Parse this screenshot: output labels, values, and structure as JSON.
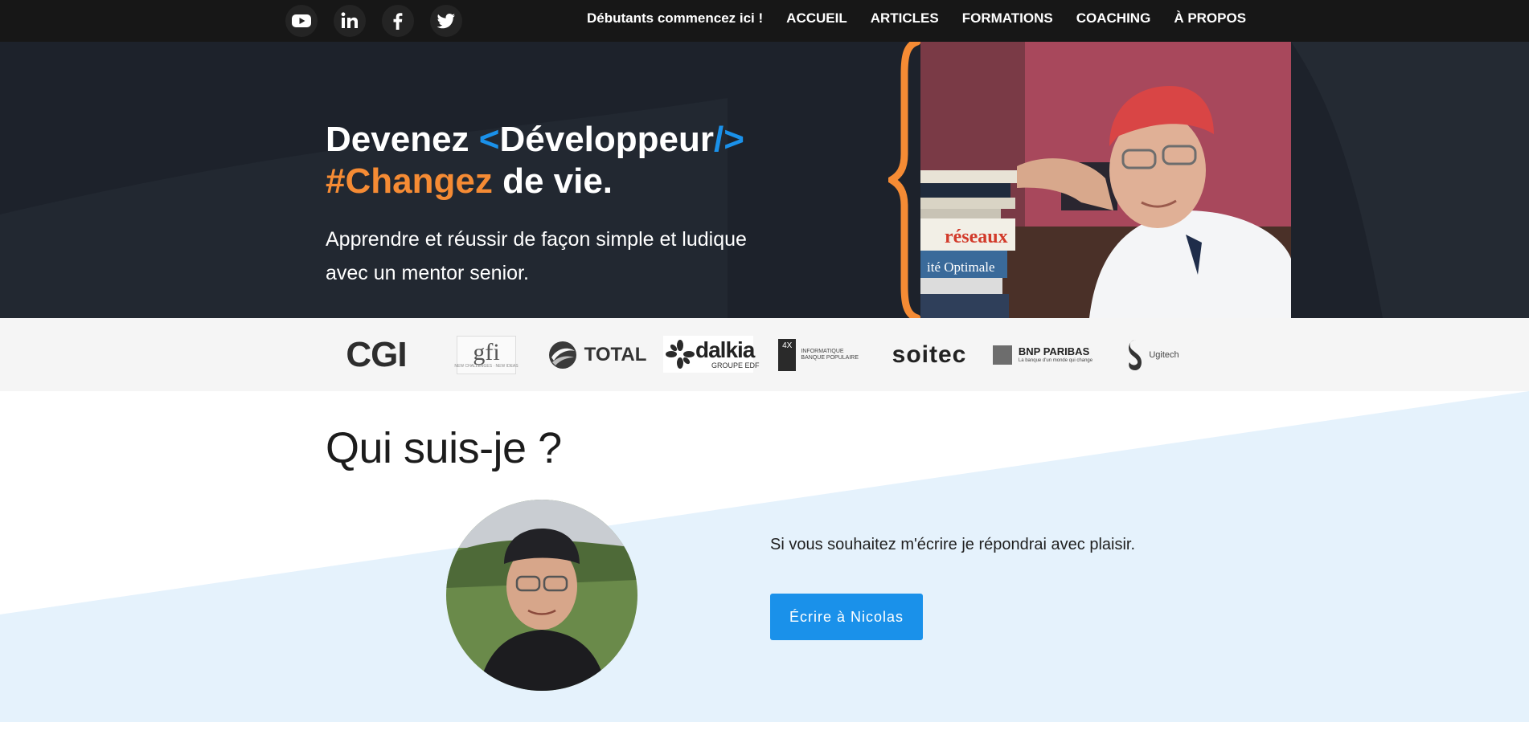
{
  "social": {
    "icons": [
      "youtube-icon",
      "linkedin-icon",
      "facebook-icon",
      "twitter-icon"
    ]
  },
  "nav": {
    "items": [
      {
        "label": "Débutants commencez ici !"
      },
      {
        "label": "ACCUEIL"
      },
      {
        "label": "ARTICLES"
      },
      {
        "label": "FORMATIONS"
      },
      {
        "label": "COACHING"
      },
      {
        "label": "À PROPOS"
      }
    ]
  },
  "hero": {
    "title_word1": "Devenez",
    "title_lt": "<",
    "title_word2": "Développeur",
    "title_end": "/>",
    "title_hashtag": "#Changez",
    "title_rest": "de vie.",
    "subtitle": "Apprendre et réussir de façon simple et ludique avec un mentor senior.",
    "photo": "photo of a smiling man in a red cap with a stack of programming books"
  },
  "clients": {
    "cgi": "CGI",
    "gfi": "gfi",
    "gfi_tag": "NEW CHALLENGES · NEW IDEAS",
    "total": "TOTAL",
    "dalkia": "dalkia",
    "dalkia_sub": "GROUPE EDF",
    "bp_mark": "4X",
    "bp_text_1": "INFORMATIQUE",
    "bp_text_2": "BANQUE POPULAIRE",
    "soitec": "soitec",
    "bnp_name": "BNP PARIBAS",
    "bnp_tag": "La banque d'un monde qui change",
    "ugitech": "Ugitech"
  },
  "about": {
    "title": "Qui suis-je ?",
    "text": "Si vous souhaitez m'écrire je répondrai avec plaisir.",
    "button_label": "Écrire à Nicolas"
  },
  "colors": {
    "accent_blue": "#1a91ea",
    "accent_orange": "#f58b34",
    "hero_bg": "#1d222b",
    "nav_bg": "#171717",
    "about_band": "#e5f2fc"
  }
}
